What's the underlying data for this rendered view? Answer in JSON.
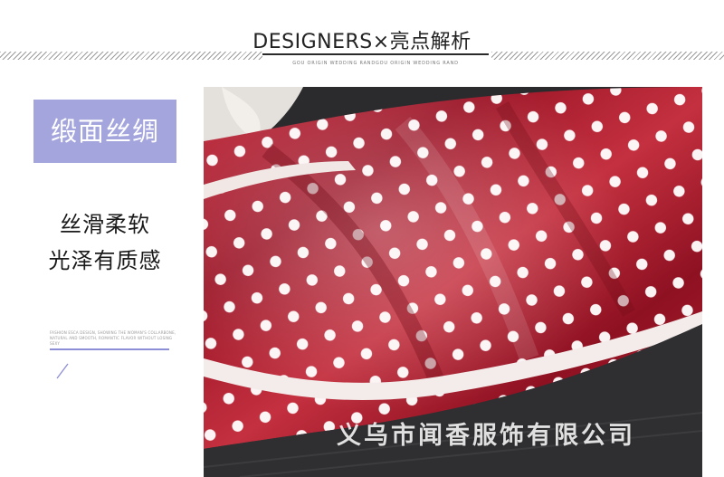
{
  "header": {
    "title": "DESIGNERS×亮点解析",
    "subtitle": "GOU ORIGIN WEDDING RANDGOU ORIGIN WEDDING RAND"
  },
  "feature": {
    "badge": "缎面丝绸",
    "line1": "丝滑柔软",
    "line2": "光泽有质感",
    "small_text": "FASHION ESCA DESIGN, SHOWING THE WOMAN'S COLLARBONE, NATURAL AND SMOOTH, ROMANTIC FLAVOR WITHOUT LOSING SEXY"
  },
  "photo": {
    "watermark": "义乌市闻香服饰有限公司"
  },
  "colors": {
    "accent": "#a4a5dd",
    "fabric": "#a7192e",
    "dots": "#ffffff"
  }
}
